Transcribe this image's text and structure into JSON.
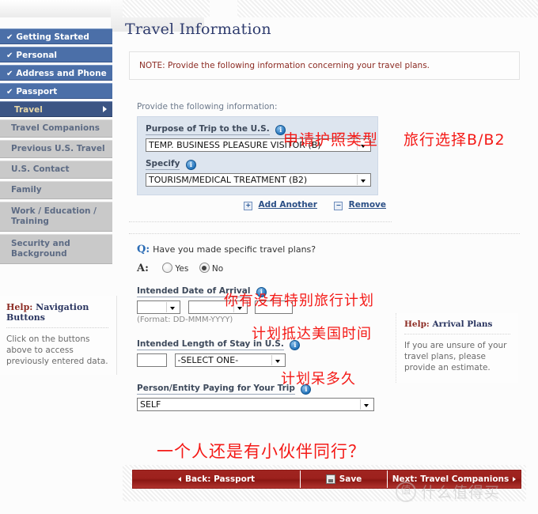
{
  "page": {
    "title": "Travel Information",
    "note": "NOTE: Provide the following information concerning your travel plans."
  },
  "sidebar": {
    "main_items": [
      {
        "label": "Getting Started",
        "state": "completed",
        "check": "✔"
      },
      {
        "label": "Personal",
        "state": "completed",
        "check": "✔"
      },
      {
        "label": "Address and Phone",
        "state": "completed",
        "check": "✔"
      },
      {
        "label": "Passport",
        "state": "completed",
        "check": "✔"
      },
      {
        "label": "Travel",
        "state": "current",
        "check": ""
      }
    ],
    "sub_items": [
      {
        "label": "Travel Companions"
      },
      {
        "label": "Previous U.S. Travel"
      },
      {
        "label": "U.S. Contact"
      },
      {
        "label": "Family"
      },
      {
        "label": "Work / Education / Training"
      },
      {
        "label": "Security and Background"
      }
    ]
  },
  "left_help": {
    "title_highlight": "Help:",
    "title_rest": " Navigation Buttons",
    "body": "Click on the buttons above to access previously entered data."
  },
  "right_help": {
    "title_highlight": "Help:",
    "title_rest": " Arrival Plans",
    "body": "If you are unsure of your travel plans, please provide an estimate."
  },
  "form": {
    "provide_label": "Provide the following information:",
    "purpose": {
      "label": "Purpose of Trip to the U.S.",
      "value": "TEMP. BUSINESS PLEASURE VISITOR (B)"
    },
    "specify": {
      "label": "Specify",
      "value": "TOURISM/MEDICAL TREATMENT (B2)"
    },
    "add_another_label": "Add Another",
    "add_another_sign": "+",
    "remove_label": "Remove",
    "remove_sign": "−",
    "question": {
      "q_letter": "Q:",
      "a_letter": "A:",
      "text": "Have you made specific travel plans?",
      "yes_label": "Yes",
      "no_label": "No",
      "selected": "No"
    },
    "arrival": {
      "label": "Intended Date of Arrival",
      "day": "",
      "month": "",
      "year": "",
      "format_note": "(Format: DD-MMM-YYYY)"
    },
    "length_of_stay": {
      "label": "Intended Length of Stay in U.S.",
      "number": "",
      "unit": "-SELECT ONE-"
    },
    "payer": {
      "label": "Person/Entity Paying for Your Trip",
      "value": "SELF"
    },
    "info_icon_glyph": "i"
  },
  "buttons": {
    "back": "Back: Passport",
    "save": "Save",
    "next": "Next: Travel Companions"
  },
  "annotations": [
    {
      "id": "cn1",
      "text": "申请护照类型"
    },
    {
      "id": "cn2",
      "text": "旅行选择B/B2"
    },
    {
      "id": "cn3",
      "text": "你有没有特别旅行计划"
    },
    {
      "id": "cn4",
      "text": "计划抵达美国时间"
    },
    {
      "id": "cn5",
      "text": "计划呆多久"
    },
    {
      "id": "cn6",
      "text": "一个人还是有小伙伴同行？"
    }
  ],
  "watermark": {
    "badge": "值",
    "text": "什么值得买"
  },
  "colors": {
    "nav_blue": "#4b6fa8",
    "nav_current": "#3c5584",
    "nav_current_text": "#e8d8a8",
    "sub_grey": "#c9c9c9",
    "panel_blue": "#dde5ef",
    "title_navy": "#2f3c6e",
    "note_red": "#8c2b23",
    "button_red": "#9d211d",
    "annotation_red": "#f41a17"
  }
}
